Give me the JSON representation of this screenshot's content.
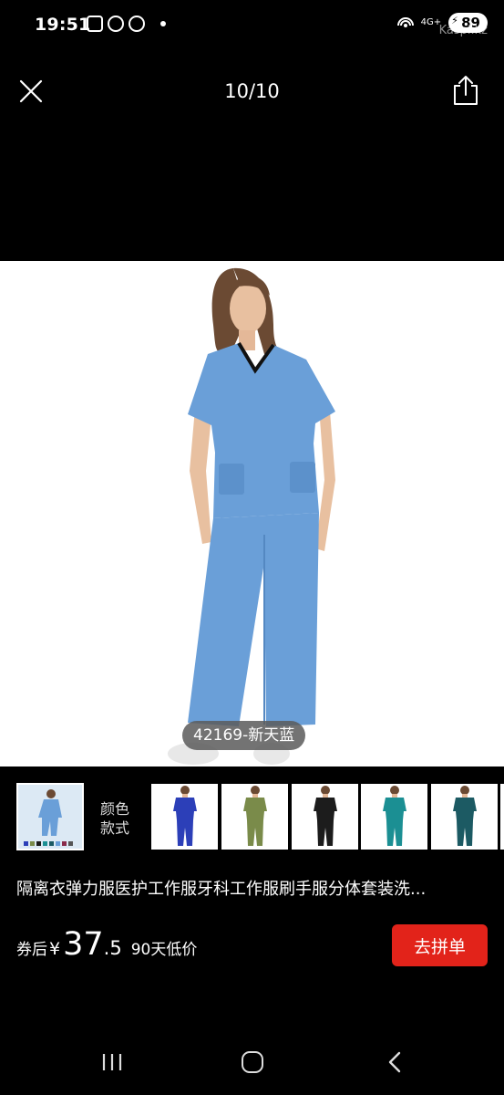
{
  "status_bar": {
    "time": "19:51",
    "network": "4G+",
    "battery": "89",
    "watermark": "Kaspi.kz"
  },
  "viewer": {
    "counter": "10/10",
    "close_icon": "close-icon",
    "share_icon": "share-icon"
  },
  "photo": {
    "tag": "42169-新天蓝",
    "scrub_color": "#6a9fd8"
  },
  "thumbnails": {
    "color_style_line1": "颜色",
    "color_style_line2": "款式",
    "colors": [
      "#2c3fb8",
      "#7a8b4a",
      "#1c1c1c",
      "#1b8f93",
      "#1c5a63"
    ]
  },
  "product": {
    "title": "隔离衣弹力服医护工作服牙科工作服刷手服分体套装洗...",
    "price_label": "券后",
    "currency": "¥",
    "price_int": "37",
    "price_dec": ".5",
    "low_price_text": "90天低价",
    "buy_label": "去拼单",
    "accent": "#e2231a"
  }
}
